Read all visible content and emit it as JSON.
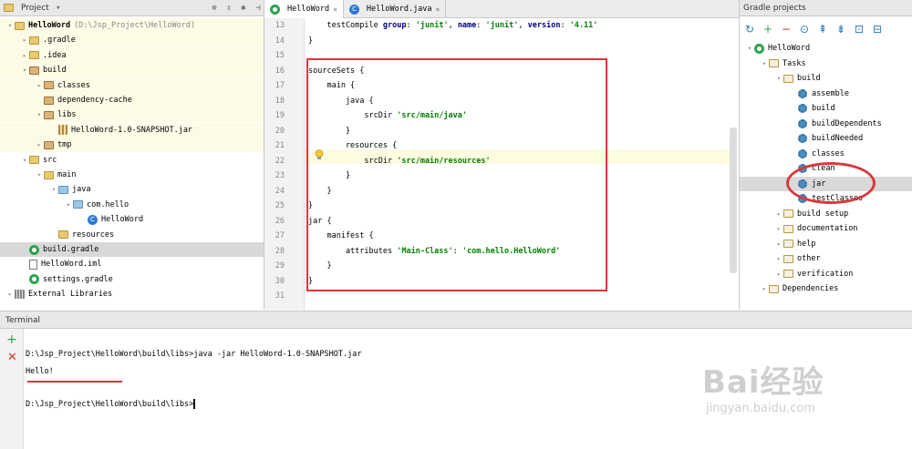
{
  "project": {
    "title": "Project",
    "tree": [
      {
        "label": "HelloWord",
        "hint": "(D:\\Jsp_Project\\HelloWord)",
        "icon": "module-icon"
      },
      {
        "label": ".gradle",
        "icon": "folder-icon"
      },
      {
        "label": ".idea",
        "icon": "folder-icon"
      },
      {
        "label": "build",
        "icon": "folder-icon"
      },
      {
        "label": "classes",
        "icon": "folder-icon"
      },
      {
        "label": "dependency-cache",
        "icon": "folder-icon"
      },
      {
        "label": "libs",
        "icon": "folder-icon"
      },
      {
        "label": "HelloWord-1.0-SNAPSHOT.jar",
        "icon": "jar-icon"
      },
      {
        "label": "tmp",
        "icon": "folder-icon"
      },
      {
        "label": "src",
        "icon": "folder-icon"
      },
      {
        "label": "main",
        "icon": "folder-icon"
      },
      {
        "label": "java",
        "icon": "source-folder-icon"
      },
      {
        "label": "com.hello",
        "icon": "package-icon"
      },
      {
        "label": "HelloWord",
        "icon": "class-icon"
      },
      {
        "label": "resources",
        "icon": "folder-icon"
      },
      {
        "label": "build.gradle",
        "icon": "gradle-icon"
      },
      {
        "label": "HelloWord.iml",
        "icon": "file-icon"
      },
      {
        "label": "settings.gradle",
        "icon": "gradle-icon"
      },
      {
        "label": "External Libraries",
        "icon": "library-icon"
      }
    ]
  },
  "editor": {
    "tabs": [
      {
        "label": "HelloWord",
        "close": "×"
      },
      {
        "label": "HelloWord.java",
        "close": "×"
      }
    ],
    "lines": [
      {
        "n": "13",
        "text": "    testCompile group: 'junit', name: 'junit', version: '4.11'"
      },
      {
        "n": "14",
        "text": "}"
      },
      {
        "n": "15",
        "text": ""
      },
      {
        "n": "16",
        "text": "sourceSets {"
      },
      {
        "n": "17",
        "text": "    main {"
      },
      {
        "n": "18",
        "text": "        java {"
      },
      {
        "n": "19",
        "text": "            srcDir 'src/main/java'"
      },
      {
        "n": "20",
        "text": "        }"
      },
      {
        "n": "21",
        "text": "        resources {"
      },
      {
        "n": "22",
        "text": "            srcDir 'src/main/resources'"
      },
      {
        "n": "23",
        "text": "        }"
      },
      {
        "n": "24",
        "text": "    }"
      },
      {
        "n": "25",
        "text": "}"
      },
      {
        "n": "26",
        "text": "jar {"
      },
      {
        "n": "27",
        "text": "    manifest {"
      },
      {
        "n": "28",
        "text": "        attributes 'Main-Class': 'com.hello.HelloWord'"
      },
      {
        "n": "29",
        "text": "    }"
      },
      {
        "n": "30",
        "text": "}"
      },
      {
        "n": "31",
        "text": ""
      }
    ]
  },
  "gradle": {
    "title": "Gradle projects",
    "toolbar": [
      "↻",
      "+",
      "−",
      "⊙",
      "⇞",
      "⇟",
      "⊡",
      "⊟"
    ],
    "tree": [
      {
        "label": "HelloWord",
        "icon": "gradle-icon"
      },
      {
        "label": "Tasks",
        "icon": "folder-icon"
      },
      {
        "label": "build",
        "icon": "folder-icon"
      },
      {
        "label": "assemble",
        "icon": "gear-icon"
      },
      {
        "label": "build",
        "icon": "gear-icon"
      },
      {
        "label": "buildDependents",
        "icon": "gear-icon"
      },
      {
        "label": "buildNeeded",
        "icon": "gear-icon"
      },
      {
        "label": "classes",
        "icon": "gear-icon"
      },
      {
        "label": "clean",
        "icon": "gear-icon"
      },
      {
        "label": "jar",
        "icon": "gear-icon"
      },
      {
        "label": "testClasses",
        "icon": "gear-icon"
      },
      {
        "label": "build setup",
        "icon": "folder-icon"
      },
      {
        "label": "documentation",
        "icon": "folder-icon"
      },
      {
        "label": "help",
        "icon": "folder-icon"
      },
      {
        "label": "other",
        "icon": "folder-icon"
      },
      {
        "label": "verification",
        "icon": "folder-icon"
      },
      {
        "label": "Dependencies",
        "icon": "folder-icon"
      }
    ]
  },
  "terminal": {
    "title": "Terminal",
    "lines": [
      "D:\\Jsp_Project\\HelloWord\\build\\libs>java -jar HelloWord-1.0-SNAPSHOT.jar",
      "Hello!",
      "",
      "D:\\Jsp_Project\\HelloWord\\build\\libs>"
    ]
  },
  "watermark": {
    "big": "Bai经验",
    "small": "jingyan.baidu.com"
  },
  "colors": {
    "annotation": "#d9383a",
    "keyword": "#000080",
    "string": "#008000"
  }
}
